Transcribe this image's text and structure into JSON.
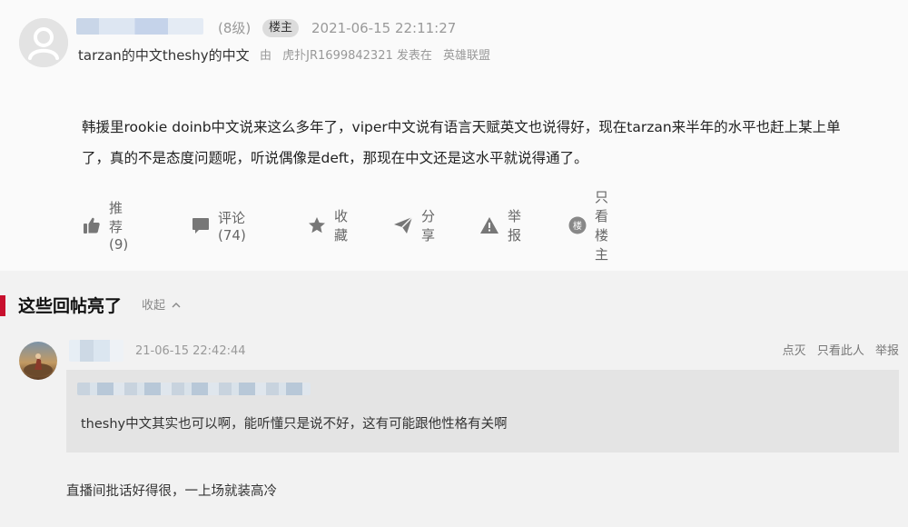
{
  "post": {
    "level": "(8级)",
    "owner_badge": "楼主",
    "time": "2021-06-15 22:11:27",
    "title": "tarzan的中文theshy的中文",
    "source_by": "由",
    "source_user": "虎扑JR1699842321",
    "source_posted_in": "发表在",
    "source_board": "英雄联盟",
    "body_line1": "韩援里rookie doinb中文说来这么多年了，viper中文说有语言天赋英文也说得好，现在tarzan来半年的水平也赶上某上单",
    "body_line2": "了，真的不是态度问题呢，听说偶像是deft，那现在中文还是这水平就说得通了。"
  },
  "actions": {
    "recommend": "推荐 (9)",
    "comment": "评论 (74)",
    "favorite": "收藏",
    "share": "分享",
    "report": "举报",
    "owner_only": "只看楼主"
  },
  "highlights": {
    "title": "这些回帖亮了",
    "collapse_label": "收起"
  },
  "reply": {
    "time": "21-06-15 22:42:44",
    "ops": [
      "点灭",
      "只看此人",
      "举报"
    ],
    "quote_text": "theshy中文其实也可以啊，能听懂只是说不好，这有可能跟他性格有关啊",
    "text": "直播间批话好得很，一上场就装高冷"
  },
  "icons": {
    "recommend": "thumbs-up-icon",
    "comment": "speech-bubble-icon",
    "favorite": "star-icon",
    "share": "paper-plane-icon",
    "report": "warning-triangle-icon",
    "owner_only": "owner-circle-icon",
    "collapse": "chevron-up-icon"
  },
  "colors": {
    "accent": "#c8102e",
    "icon": "#777777",
    "muted_text": "#999999"
  }
}
